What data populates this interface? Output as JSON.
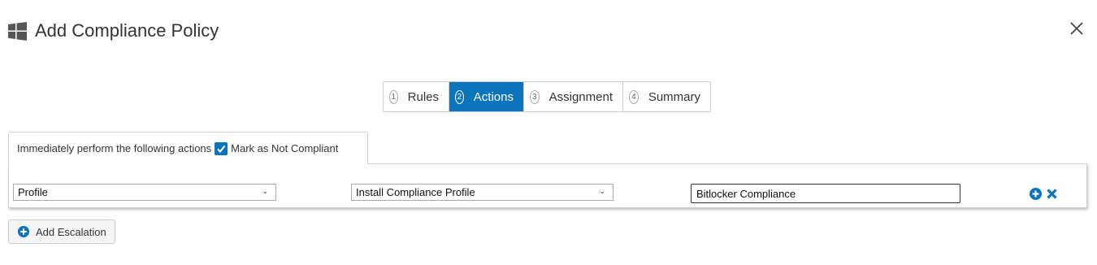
{
  "window": {
    "title": "Add Compliance Policy",
    "title_icon": "windows-icon",
    "close_icon": "close-icon"
  },
  "steps": [
    {
      "number": "1",
      "label": "Rules",
      "active": false
    },
    {
      "number": "2",
      "label": "Actions",
      "active": true
    },
    {
      "number": "3",
      "label": "Assignment",
      "active": false
    },
    {
      "number": "4",
      "label": "Summary",
      "active": false
    }
  ],
  "action_tab": {
    "label": "Immediately perform the following actions",
    "checkbox_label": "Mark as Not Compliant",
    "checked": true
  },
  "action_row": {
    "type_select": "Profile",
    "action_select": "Install Compliance Profile",
    "profile_name": "Bitlocker Compliance",
    "add_icon": "plus-circle-icon",
    "remove_icon": "x-icon"
  },
  "add_escalation": {
    "label": "Add Escalation",
    "icon": "plus-circle-icon"
  },
  "colors": {
    "accent": "#0a74bd",
    "border": "#cccccc"
  }
}
